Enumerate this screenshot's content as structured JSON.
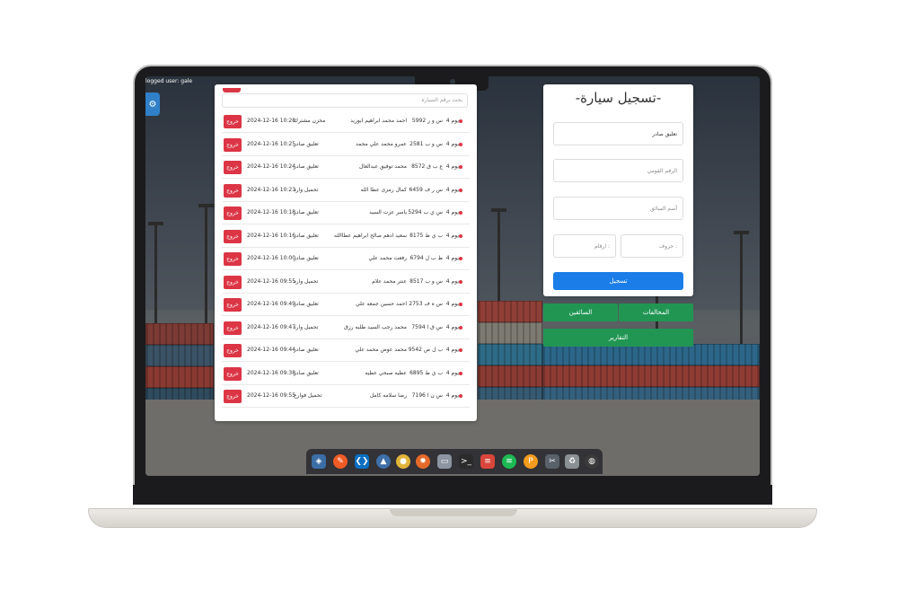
{
  "session": {
    "logged_user": "logged user: gale"
  },
  "search": {
    "placeholder": "بحث برقم السيارة"
  },
  "rows": [
    {
      "duration": "4 يوم",
      "plate": "س و ر 5992",
      "driver": "احمد محمد ابراهيم ابوزيد",
      "status": "مخزن مشترك",
      "datetime": "2024-12-16 10:28",
      "delete": "خروج"
    },
    {
      "duration": "4 يوم",
      "plate": "س و ب 2581",
      "driver": "عمرو محمد علي محمد",
      "status": "تعليق صادر",
      "datetime": "2024-12-16 10:25",
      "delete": "خروج"
    },
    {
      "duration": "4 يوم",
      "plate": "ع ب ق 8572",
      "driver": "محمد توفيق عبدالعال",
      "status": "تعليق صادر",
      "datetime": "2024-12-16 10:24",
      "delete": "خروج"
    },
    {
      "duration": "4 يوم",
      "plate": "س ر ف 6459",
      "driver": "كمال رمزى عطا الله",
      "status": "تحميل وارد",
      "datetime": "2024-12-16 10:23",
      "delete": "خروج"
    },
    {
      "duration": "4 يوم",
      "plate": "س ي ب 5294",
      "driver": "ياسر عزت السيد",
      "status": "تعليق صادر",
      "datetime": "2024-12-16 10:18",
      "delete": "خروج"
    },
    {
      "duration": "4 يوم",
      "plate": "ب ي ط 8175",
      "driver": "سعيد ادهم صالح ابراهيم عطاالله",
      "status": "تعليق صادر",
      "datetime": "2024-12-16 10:16",
      "delete": "خروج"
    },
    {
      "duration": "4 يوم",
      "plate": "ط ب ل 6794",
      "driver": "رفعت محمد علي",
      "status": "تعليق صادر",
      "datetime": "2024-12-16 10:00",
      "delete": "خروج"
    },
    {
      "duration": "4 يوم",
      "plate": "س و ب 8517",
      "driver": "عنتر محمد علام",
      "status": "تحميل وارد",
      "datetime": "2024-12-16 09:55",
      "delete": "خروج"
    },
    {
      "duration": "4 يوم",
      "plate": "س ه ف 2753",
      "driver": "احمد حسين جمعه علي",
      "status": "تعليق صادر",
      "datetime": "2024-12-16 09:49",
      "delete": "خروج"
    },
    {
      "duration": "4 يوم",
      "plate": "س ق ا 7594",
      "driver": "محمد رجب السيد طلبه رزق",
      "status": "تحميل وارد",
      "datetime": "2024-12-16 09:47",
      "delete": "خروج"
    },
    {
      "duration": "4 يوم",
      "plate": "ب ل ص 9542",
      "driver": "محمد عوض محمد علي",
      "status": "تعليق صادر",
      "datetime": "2024-12-16 09:44",
      "delete": "خروج"
    },
    {
      "duration": "4 يوم",
      "plate": "ب ي ط 6895",
      "driver": "عطيه صبحي عطيه",
      "status": "تعليق صادر",
      "datetime": "2024-12-16 09:38",
      "delete": "خروج"
    },
    {
      "duration": "4 يوم",
      "plate": "س ن ا 7196",
      "driver": "رضا سلامه كامل",
      "status": "تحميل فوارغ",
      "datetime": "2024-12-16 09:55",
      "delete": "خروج"
    }
  ],
  "form": {
    "title": "-تسجيل سيارة-",
    "type_value": "تعليق صادر",
    "national_id_placeholder": "الرقم القومي",
    "driver_name_placeholder": "أسم السائق",
    "letters_placeholder": "حروف :",
    "numbers_placeholder": "ارقام :",
    "submit_label": "تسجيل"
  },
  "nav": {
    "violations_label": "المخالفات",
    "drivers_label": "السائقين",
    "reports_label": "التقارير"
  },
  "dock_icons": [
    "ubuntu-icon",
    "recycle-bin-icon",
    "tool-icon",
    "pencil-app-icon",
    "spotify-icon",
    "todoist-icon",
    "terminal-icon",
    "files-icon",
    "firefox-icon",
    "chrome-icon",
    "inkscape-icon",
    "vscode-icon",
    "postman-icon",
    "network-icon"
  ],
  "colors": {
    "accent": "#1a7de8",
    "danger": "#dc3545",
    "success": "#219653"
  }
}
